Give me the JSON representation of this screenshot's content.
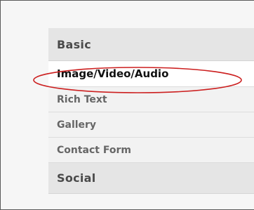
{
  "sections": [
    {
      "title": "Basic",
      "items": [
        {
          "label": "Image/Video/Audio",
          "selected": true
        },
        {
          "label": "Rich Text",
          "selected": false
        },
        {
          "label": "Gallery",
          "selected": false
        },
        {
          "label": "Contact Form",
          "selected": false
        }
      ]
    },
    {
      "title": "Social",
      "items": []
    }
  ],
  "annotation": {
    "type": "ellipse",
    "color": "#cc1f1f",
    "target": "Image/Video/Audio"
  },
  "colors": {
    "header_bg": "#e5e5e5",
    "item_bg": "#f2f2f2",
    "selected_bg": "#ffffff",
    "header_text": "#4a4a4a",
    "item_text": "#666666",
    "selected_text": "#111111"
  }
}
